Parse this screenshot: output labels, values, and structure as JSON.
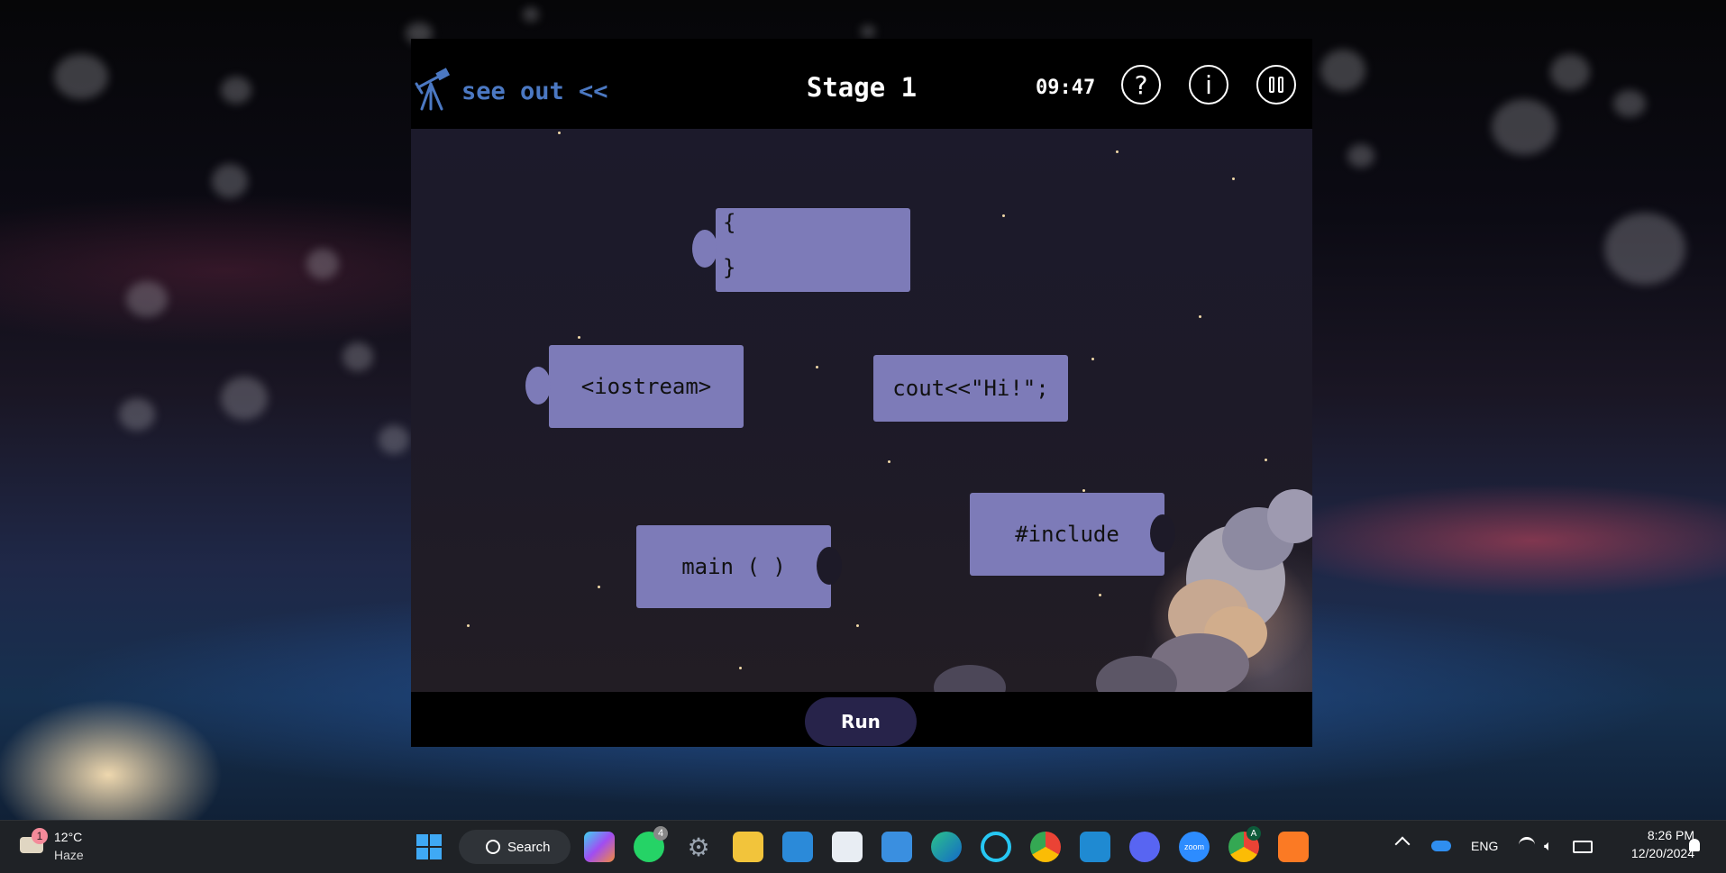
{
  "game": {
    "logo_text": "see out <<",
    "stage_title": "Stage 1",
    "timer": "09:47",
    "buttons": {
      "help": "?",
      "info": "i",
      "pause": "pause"
    },
    "blocks": [
      {
        "id": "braces",
        "line1": "{",
        "line2": "}"
      },
      {
        "id": "iostream",
        "label": "<iostream>"
      },
      {
        "id": "cout",
        "label": "cout<<\"Hi!\";"
      },
      {
        "id": "main",
        "label": "main ( )"
      },
      {
        "id": "include",
        "label": "#include"
      }
    ],
    "run_label": "Run",
    "colors": {
      "block": "#7d7bb8",
      "run_button": "#27234a",
      "logo": "#4b78c2"
    }
  },
  "taskbar": {
    "weather": {
      "temp": "12°C",
      "condition": "Haze",
      "badge": "1"
    },
    "search_label": "Search",
    "whatsapp_badge": "4",
    "chrome_badge": "A",
    "apps": [
      "start-icon",
      "search",
      "copilot-icon",
      "whatsapp-icon",
      "settings-icon",
      "file-explorer-icon",
      "desktop-icon",
      "store-icon",
      "mail-icon",
      "edge-icon",
      "alexa-icon",
      "chrome-icon",
      "vscode-icon",
      "discord-icon",
      "zoom-icon",
      "chrome-profile-icon",
      "xampp-icon"
    ],
    "zoom_label": "zoom",
    "language": "ENG",
    "time": "8:26 PM",
    "date": "12/20/2024"
  }
}
